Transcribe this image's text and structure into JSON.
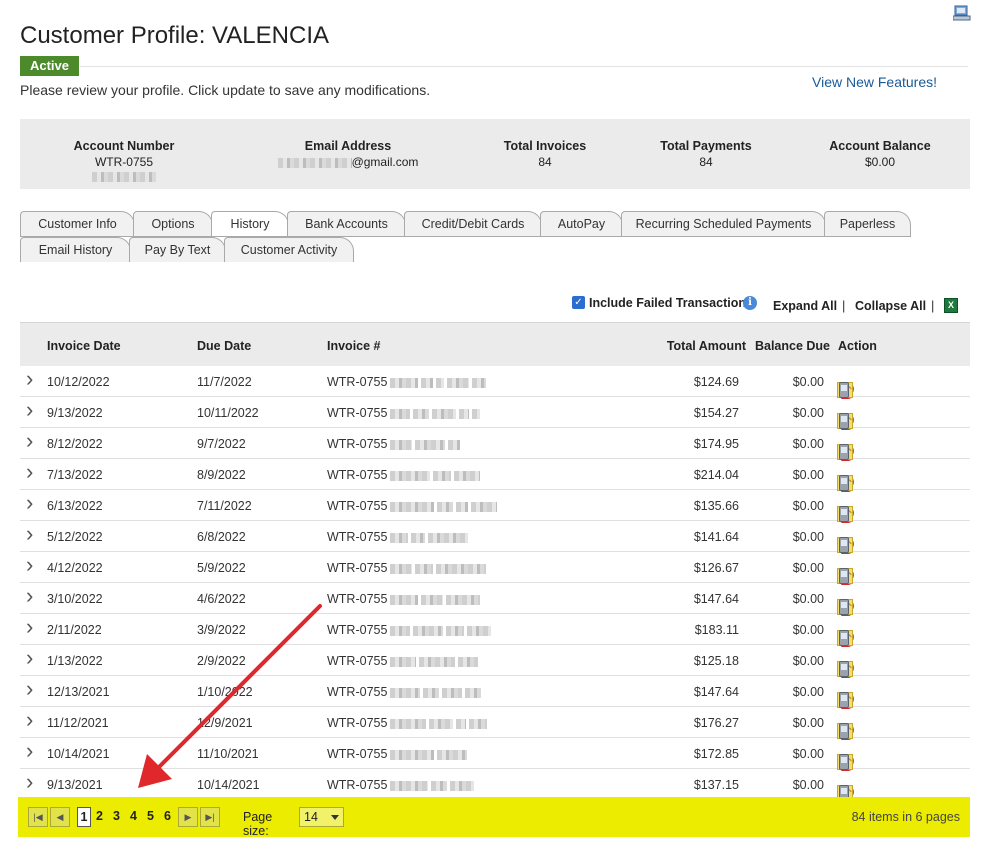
{
  "header": {
    "title": "Customer Profile: VALENCIA",
    "status": "Active",
    "subtitle": "Please review your profile. Click update to save any modifications.",
    "new_features_link": "View New Features!"
  },
  "summary": {
    "account_number_label": "Account Number",
    "account_number_value": "WTR-0755",
    "email_label": "Email Address",
    "email_value": "@gmail.com",
    "total_invoices_label": "Total Invoices",
    "total_invoices_value": "84",
    "total_payments_label": "Total Payments",
    "total_payments_value": "84",
    "account_balance_label": "Account Balance",
    "account_balance_value": "$0.00"
  },
  "tabs_row1": [
    "Customer Info",
    "Options",
    "History",
    "Bank Accounts",
    "Credit/Debit Cards",
    "AutoPay",
    "Recurring Scheduled Payments",
    "Paperless"
  ],
  "tabs_row2": [
    "Email History",
    "Pay By Text",
    "Customer Activity"
  ],
  "active_tab": "History",
  "toolbar": {
    "include_failed": "Include Failed Transactions",
    "include_failed_checked": true,
    "expand_all": "Expand All",
    "separator": "|",
    "collapse_all": "Collapse All"
  },
  "grid": {
    "columns": [
      "Invoice Date",
      "Due Date",
      "Invoice #",
      "Total Amount",
      "Balance Due",
      "Action"
    ],
    "rows": [
      {
        "invoice_date": "10/12/2022",
        "due_date": "11/7/2022",
        "invoice": "WTR-0755",
        "total": "$124.69",
        "balance": "$0.00"
      },
      {
        "invoice_date": "9/13/2022",
        "due_date": "10/11/2022",
        "invoice": "WTR-0755",
        "total": "$154.27",
        "balance": "$0.00"
      },
      {
        "invoice_date": "8/12/2022",
        "due_date": "9/7/2022",
        "invoice": "WTR-0755",
        "total": "$174.95",
        "balance": "$0.00"
      },
      {
        "invoice_date": "7/13/2022",
        "due_date": "8/9/2022",
        "invoice": "WTR-0755",
        "total": "$214.04",
        "balance": "$0.00"
      },
      {
        "invoice_date": "6/13/2022",
        "due_date": "7/11/2022",
        "invoice": "WTR-0755",
        "total": "$135.66",
        "balance": "$0.00"
      },
      {
        "invoice_date": "5/12/2022",
        "due_date": "6/8/2022",
        "invoice": "WTR-0755",
        "total": "$141.64",
        "balance": "$0.00"
      },
      {
        "invoice_date": "4/12/2022",
        "due_date": "5/9/2022",
        "invoice": "WTR-0755",
        "total": "$126.67",
        "balance": "$0.00"
      },
      {
        "invoice_date": "3/10/2022",
        "due_date": "4/6/2022",
        "invoice": "WTR-0755",
        "total": "$147.64",
        "balance": "$0.00"
      },
      {
        "invoice_date": "2/11/2022",
        "due_date": "3/9/2022",
        "invoice": "WTR-0755",
        "total": "$183.11",
        "balance": "$0.00"
      },
      {
        "invoice_date": "1/13/2022",
        "due_date": "2/9/2022",
        "invoice": "WTR-0755",
        "total": "$125.18",
        "balance": "$0.00"
      },
      {
        "invoice_date": "12/13/2021",
        "due_date": "1/10/2022",
        "invoice": "WTR-0755",
        "total": "$147.64",
        "balance": "$0.00"
      },
      {
        "invoice_date": "11/12/2021",
        "due_date": "12/9/2021",
        "invoice": "WTR-0755",
        "total": "$176.27",
        "balance": "$0.00"
      },
      {
        "invoice_date": "10/14/2021",
        "due_date": "11/10/2021",
        "invoice": "WTR-0755",
        "total": "$172.85",
        "balance": "$0.00"
      },
      {
        "invoice_date": "9/13/2021",
        "due_date": "10/14/2021",
        "invoice": "WTR-0755",
        "total": "$137.15",
        "balance": "$0.00"
      }
    ],
    "action_icons": [
      "view-icon",
      "pdf-icon",
      "schedule-icon",
      "pay-icon",
      "email-icon",
      "text-phone-icon"
    ]
  },
  "pager": {
    "pages": [
      "1",
      "2",
      "3",
      "4",
      "5",
      "6"
    ],
    "current_page": "1",
    "page_size_label": "Page size:",
    "page_size_value": "14",
    "info": "84 items in 6 pages"
  },
  "colors": {
    "active_badge": "#4c8a2c",
    "link": "#1a5a96",
    "pager_highlight": "#ecec00",
    "annotation_arrow": "#e0272b"
  }
}
